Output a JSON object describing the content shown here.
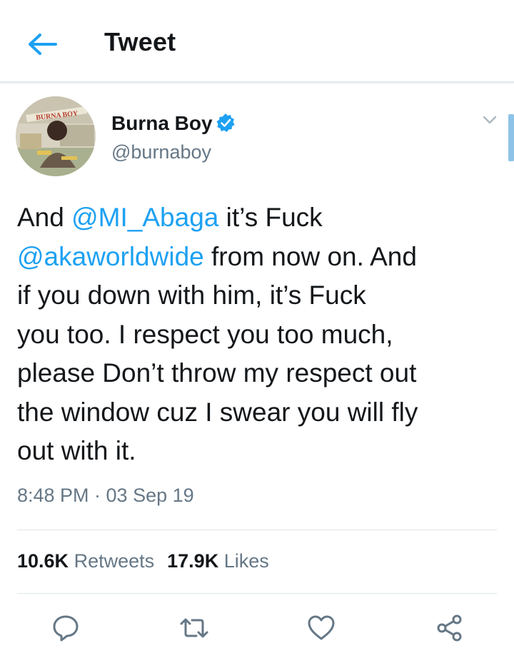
{
  "header": {
    "title": "Tweet",
    "back_icon": "back-arrow-icon"
  },
  "author": {
    "name": "Burna Boy",
    "handle": "@burnaboy",
    "verified_icon": "verified-badge-icon",
    "avatar_text": "BURNA BOY"
  },
  "tweet": {
    "lines": [
      [
        {
          "text": "And ",
          "mention": false
        },
        {
          "text": "@MI_Abaga",
          "mention": true
        },
        {
          "text": " it’s Fuck",
          "mention": false
        }
      ],
      [
        {
          "text": "@akaworldwide",
          "mention": true
        },
        {
          "text": " from now on. And",
          "mention": false
        }
      ],
      [
        {
          "text": "if you down with him, it’s Fuck",
          "mention": false
        }
      ],
      [
        {
          "text": "you too. I respect you too much,",
          "mention": false
        }
      ],
      [
        {
          "text": "please Don’t throw my respect out",
          "mention": false
        }
      ],
      [
        {
          "text": "the window cuz I swear you will fly",
          "mention": false
        }
      ],
      [
        {
          "text": "out with it.",
          "mention": false
        }
      ]
    ],
    "timestamp": "8:48 PM · 03 Sep 19"
  },
  "stats": {
    "retweets_count": "10.6K",
    "retweets_label": "Retweets",
    "likes_count": "17.9K",
    "likes_label": "Likes"
  },
  "actions": [
    "reply-icon",
    "retweet-icon",
    "like-icon",
    "share-icon"
  ],
  "colors": {
    "accent": "#1da1f2",
    "secondary_text": "#657786",
    "divider": "#dfe5ea"
  }
}
